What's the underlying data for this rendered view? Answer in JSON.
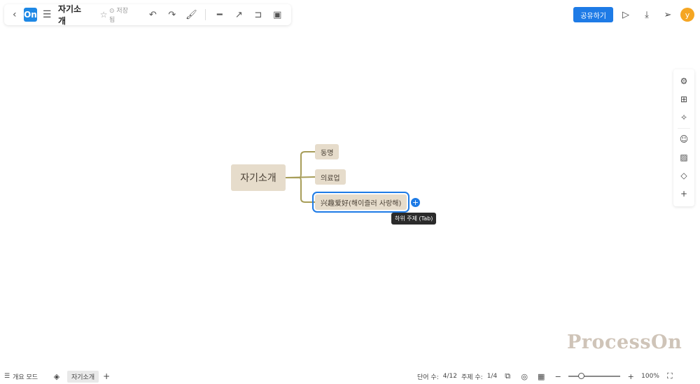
{
  "header": {
    "back_icon": "‹",
    "logo": "On",
    "title": "자기소개",
    "saved_status": "⊙ 저장됨",
    "share_label": "공유하기",
    "avatar_letter": "y"
  },
  "map": {
    "root": "자기소개",
    "children": [
      "동명",
      "의료업",
      "兴趣爱好(해이즐러 사랑해)"
    ],
    "tooltip": "하위 주제 (Tab)"
  },
  "footer": {
    "outline_label": "개요 모드",
    "sheet_label": "자기소개",
    "word_count_label": "단어 수:",
    "word_count_value": "4/12",
    "topic_count_label": "주제 수:",
    "topic_count_value": "1/4",
    "zoom": "100%"
  },
  "watermark": "ProcessOn",
  "colors": {
    "accent": "#1e7be6",
    "node_bg": "#e6dccb",
    "connector": "#a79d58"
  }
}
